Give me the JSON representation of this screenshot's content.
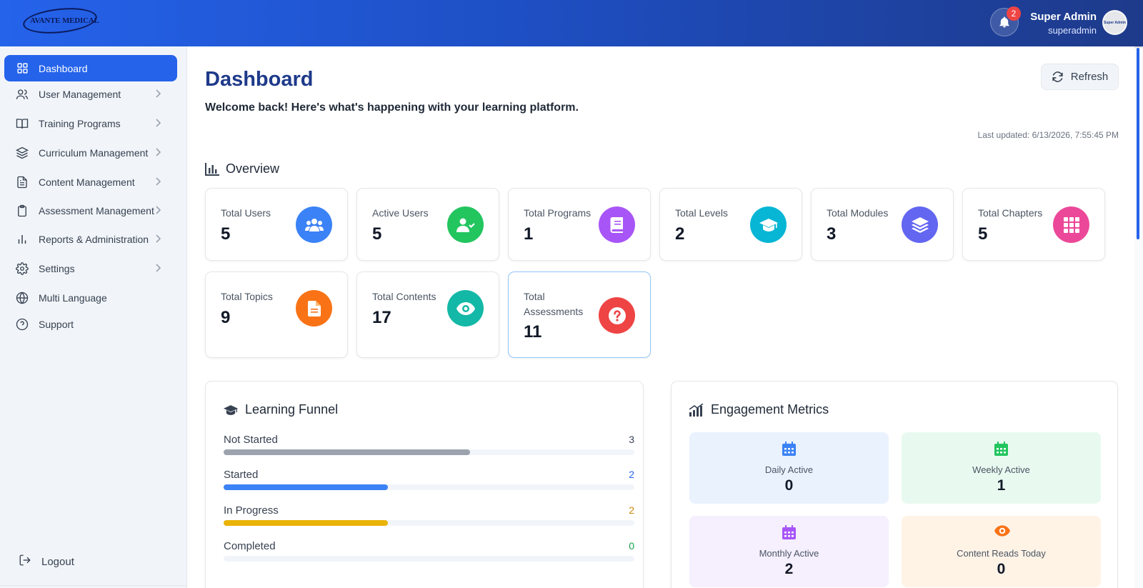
{
  "header": {
    "logo_text": "AVANTE MEDICAL",
    "notification_count": "2",
    "user_name": "Super Admin",
    "user_role": "superadmin",
    "avatar_text": "Super Admin"
  },
  "sidebar": {
    "items": [
      {
        "label": "Dashboard",
        "icon": "grid-icon",
        "active": true,
        "has_chevron": false
      },
      {
        "label": "User Management",
        "icon": "users-icon",
        "has_chevron": true
      },
      {
        "label": "Training Programs",
        "icon": "book-open-icon",
        "has_chevron": true
      },
      {
        "label": "Curriculum Management",
        "icon": "layers-icon",
        "has_chevron": true
      },
      {
        "label": "Content Management",
        "icon": "file-text-icon",
        "has_chevron": true
      },
      {
        "label": "Assessment Management",
        "icon": "clipboard-icon",
        "has_chevron": true
      },
      {
        "label": "Reports & Administration",
        "icon": "bar-chart-icon",
        "has_chevron": true
      },
      {
        "label": "Settings",
        "icon": "gear-icon",
        "has_chevron": true
      },
      {
        "label": "Multi Language",
        "icon": "globe-icon",
        "has_chevron": false
      },
      {
        "label": "Support",
        "icon": "help-circle-icon",
        "has_chevron": false
      }
    ],
    "logout_label": "Logout"
  },
  "main": {
    "title": "Dashboard",
    "subtitle": "Welcome back! Here's what's happening with your learning platform.",
    "refresh_label": "Refresh",
    "last_updated": "Last updated: 6/13/2026, 7:55:45 PM",
    "overview_title": "Overview",
    "stats": [
      {
        "label": "Total Users",
        "value": "5",
        "icon": "users-icon",
        "color": "#3b82f6"
      },
      {
        "label": "Active Users",
        "value": "5",
        "icon": "user-check-icon",
        "color": "#22c55e"
      },
      {
        "label": "Total Programs",
        "value": "1",
        "icon": "book-icon",
        "color": "#a855f7"
      },
      {
        "label": "Total Levels",
        "value": "2",
        "icon": "graduation-cap-icon",
        "color": "#06b6d4"
      },
      {
        "label": "Total Modules",
        "value": "3",
        "icon": "layers-icon",
        "color": "#6366f1"
      },
      {
        "label": "Total Chapters",
        "value": "5",
        "icon": "grid-icon",
        "color": "#ec4899"
      },
      {
        "label": "Total Topics",
        "value": "9",
        "icon": "file-text-icon",
        "color": "#f97316"
      },
      {
        "label": "Total Contents",
        "value": "17",
        "icon": "eye-icon",
        "color": "#14b8a6"
      },
      {
        "label": "Total Assessments",
        "value": "11",
        "icon": "question-circle-icon",
        "color": "#ef4444"
      }
    ],
    "funnel": {
      "title": "Learning Funnel",
      "max": 5,
      "rows": [
        {
          "label": "Not Started",
          "count": "3",
          "value": 0.6,
          "bar_color": "#9ca3af",
          "count_color": "#374151"
        },
        {
          "label": "Started",
          "count": "2",
          "value": 0.4,
          "bar_color": "#3b82f6",
          "count_color": "#2563eb"
        },
        {
          "label": "In Progress",
          "count": "2",
          "value": 0.4,
          "bar_color": "#eab308",
          "count_color": "#ca8a04"
        },
        {
          "label": "Completed",
          "count": "0",
          "value": 0,
          "bar_color": "#22c55e",
          "count_color": "#16a34a"
        }
      ]
    },
    "engagement": {
      "title": "Engagement Metrics",
      "metrics": [
        {
          "label": "Daily Active",
          "value": "0",
          "icon": "calendar-icon",
          "icon_color": "#3b82f6",
          "bg": "#eaf2fe"
        },
        {
          "label": "Weekly Active",
          "value": "1",
          "icon": "calendar-icon",
          "icon_color": "#22c55e",
          "bg": "#e8faf0"
        },
        {
          "label": "Monthly Active",
          "value": "2",
          "icon": "calendar-icon",
          "icon_color": "#a855f7",
          "bg": "#f5effe"
        },
        {
          "label": "Content Reads Today",
          "value": "0",
          "icon": "eye-icon",
          "icon_color": "#f97316",
          "bg": "#fff3e6"
        }
      ]
    }
  }
}
